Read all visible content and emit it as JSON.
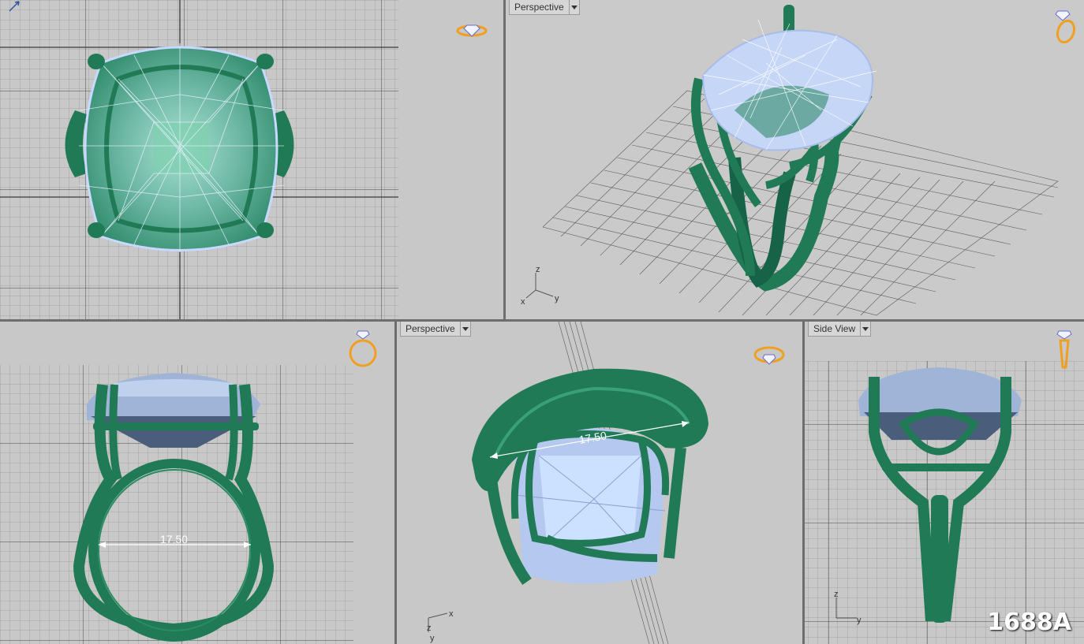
{
  "viewports": {
    "top": {
      "label": ""
    },
    "perspective_top": {
      "label": "Perspective"
    },
    "front": {
      "label": ""
    },
    "perspective_bottom": {
      "label": "Perspective"
    },
    "side": {
      "label": "Side View"
    }
  },
  "dimensions": {
    "front_ring_size": "17.50",
    "perspective_ring_size": "17.50"
  },
  "axes": {
    "z": "z",
    "x": "x",
    "y": "y"
  },
  "model_id": "1688A",
  "colors": {
    "metal": "#1f7a55",
    "metal_dark": "#0e4a32",
    "stone": "#b8c8f0",
    "grid_bg": "#c8c8c8",
    "grid_line": "#8a8a8a",
    "view_cube": "#f0a020"
  },
  "icons": {
    "view_cube": "ring-view-cube-icon",
    "axis": "axis-tripod-icon",
    "dropdown": "chevron-down-icon"
  }
}
